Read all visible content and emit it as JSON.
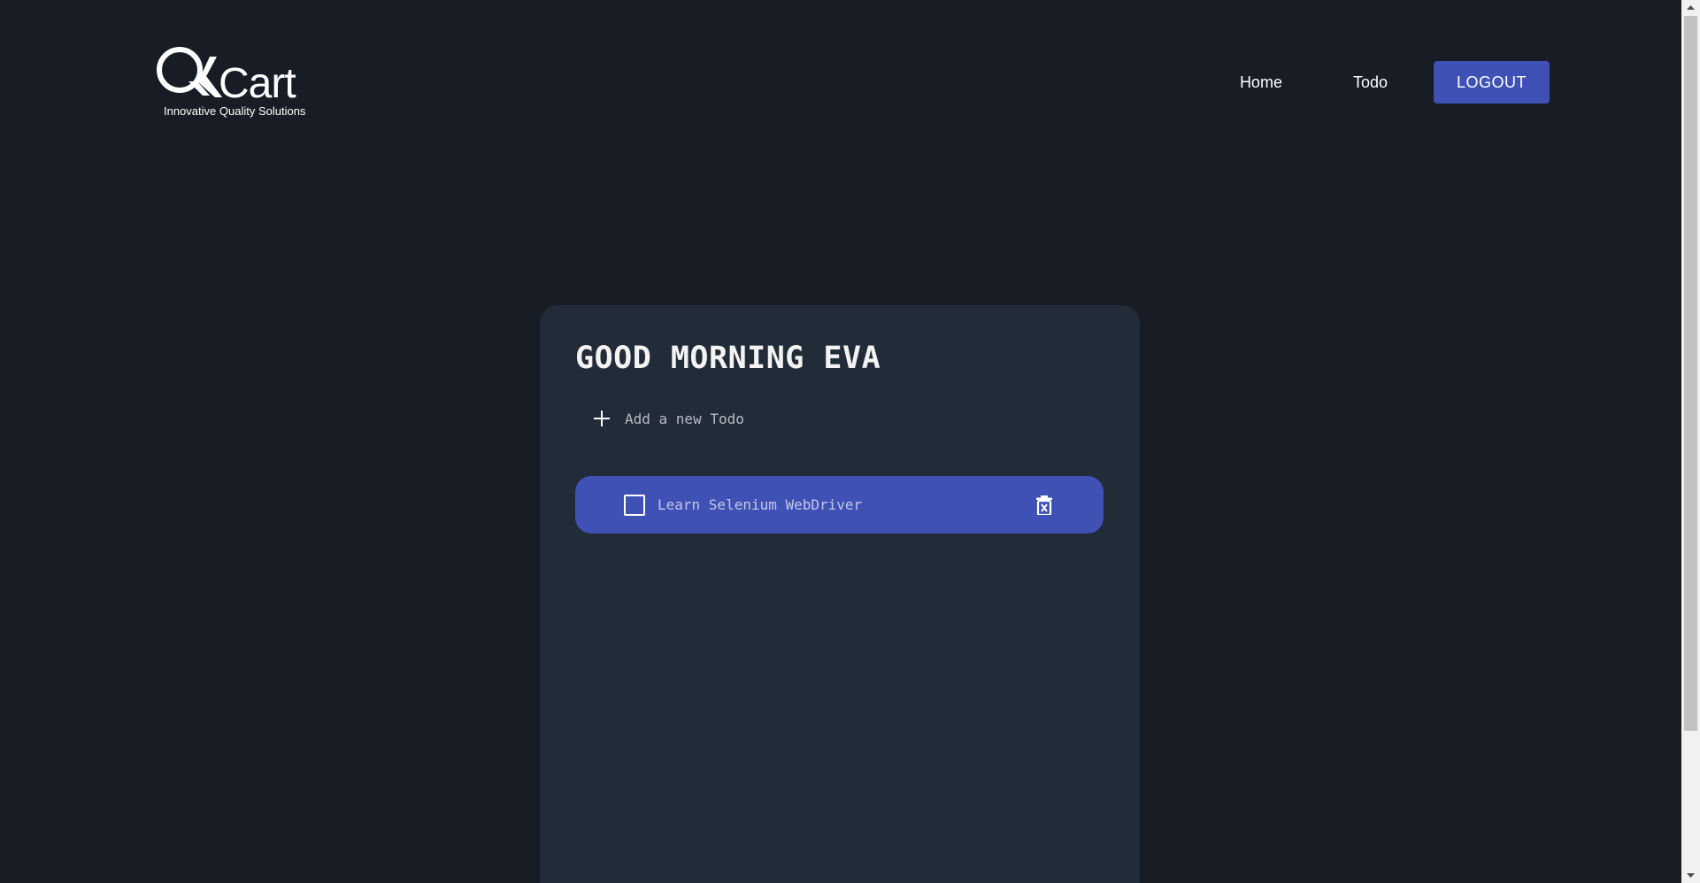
{
  "header": {
    "logo": {
      "brand": "QKart",
      "tagline": "Innovative Quality Solutions"
    },
    "nav": {
      "home_label": "Home",
      "todo_label": "Todo",
      "logout_label": "LOGOUT"
    }
  },
  "main": {
    "greeting": "GOOD MORNING EVA",
    "add_todo": {
      "placeholder": "Add a new Todo",
      "icon": "plus-icon"
    },
    "todos": [
      {
        "text": "Learn Selenium WebDriver",
        "completed": false,
        "delete_icon": "trash-icon"
      }
    ]
  },
  "colors": {
    "background": "#171c25",
    "card": "#222b38",
    "accent": "#3f51b5",
    "text": "#ffffff"
  }
}
